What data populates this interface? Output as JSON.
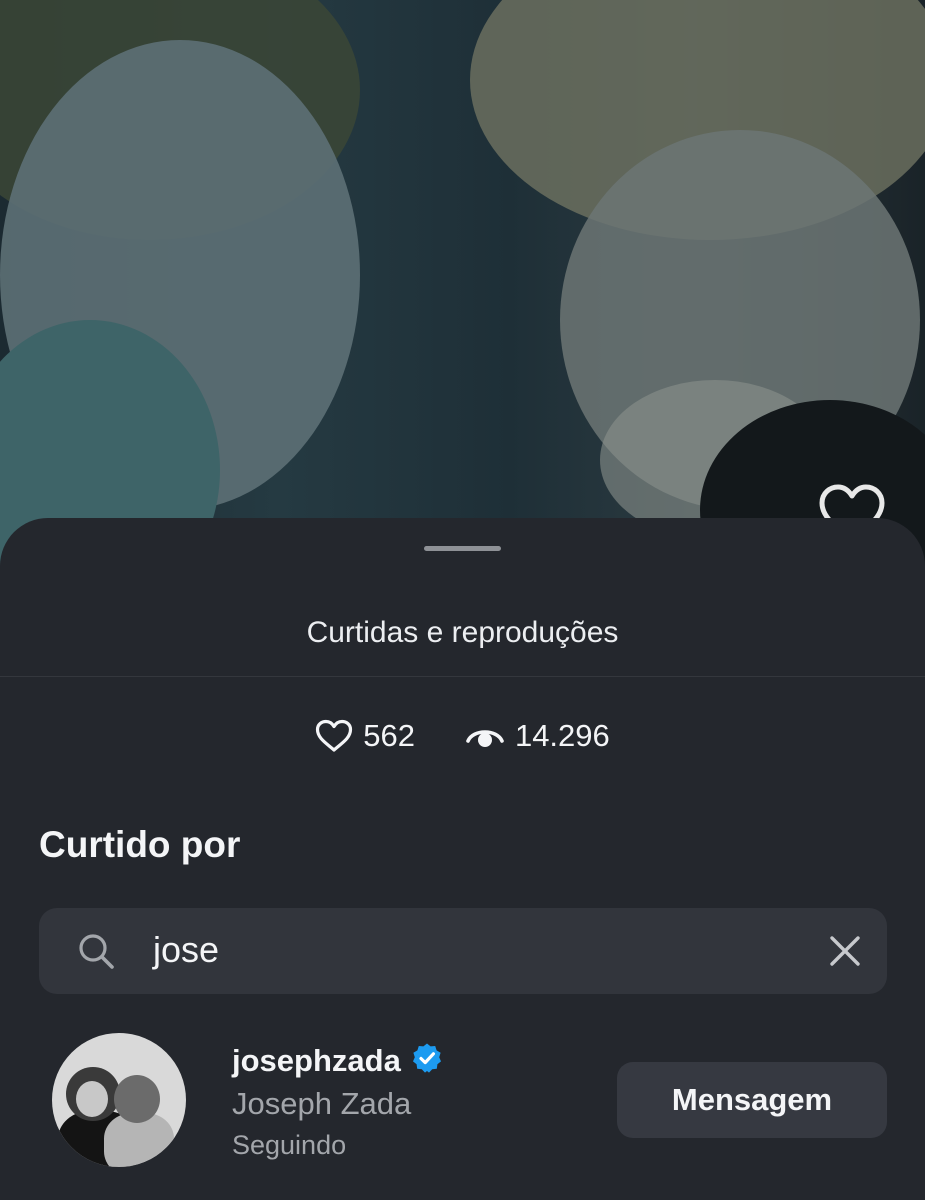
{
  "sheet": {
    "title": "Curtidas e reproduções"
  },
  "stats": {
    "likes": "562",
    "views": "14.296"
  },
  "liked_by": {
    "heading": "Curtido por"
  },
  "search": {
    "value": "jose"
  },
  "results": [
    {
      "username": "josephzada",
      "full_name": "Joseph Zada",
      "status": "Seguindo",
      "verified": true,
      "action_label": "Mensagem"
    }
  ],
  "colors": {
    "sheet_background": "#24272d",
    "search_background": "#32353c",
    "button_background": "#363941",
    "verified_badge": "#1d9bf0",
    "secondary_text": "#a3a6ab"
  },
  "icons": {
    "like": "heart-icon",
    "views": "eye-icon",
    "search": "search-icon",
    "clear": "close-icon",
    "verified": "verified-badge-icon"
  }
}
